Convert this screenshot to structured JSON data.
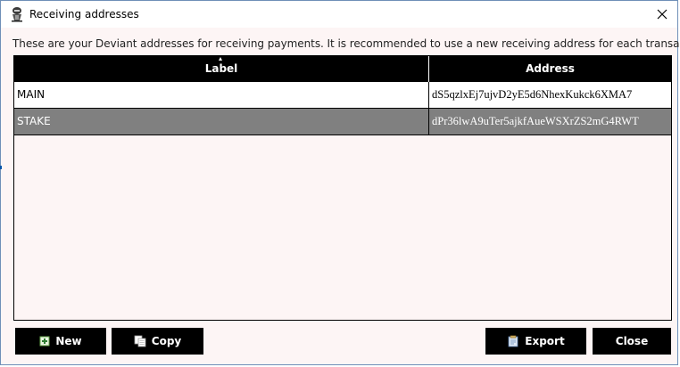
{
  "window": {
    "title": "Receiving addresses",
    "icon": "deviant-app-icon",
    "close_icon": "close-icon"
  },
  "description": "These are your Deviant addresses for receiving payments. It is recommended to use a new receiving address for each transaction.",
  "table": {
    "columns": [
      "Label",
      "Address"
    ],
    "sort_column": "Label",
    "rows": [
      {
        "label": "MAIN",
        "address": "dS5qzlxEj7ujvD2yE5d6NhexKukck6XMA7"
      },
      {
        "label": "STAKE",
        "address": "dPr36lwA9uTer5ajkfAueWSXrZS2mG4RWT"
      }
    ],
    "selected_row": 1
  },
  "buttons": {
    "new_label": "New",
    "copy_label": "Copy",
    "export_label": "Export",
    "close_label": "Close"
  },
  "colors": {
    "header_bg": "#000000",
    "selected_row_bg": "#808080",
    "button_bg": "#000000",
    "window_bg": "#fdf5f5"
  }
}
